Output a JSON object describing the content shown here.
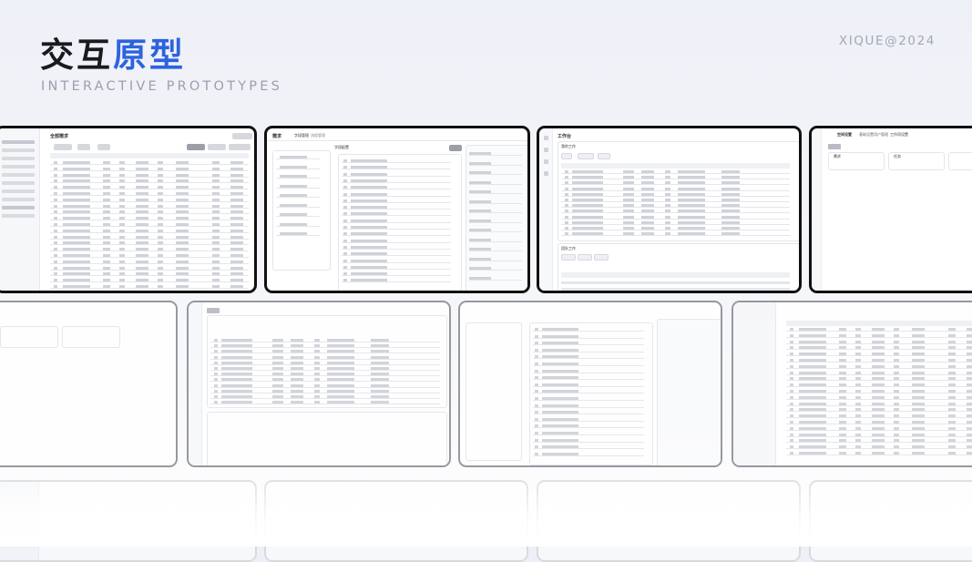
{
  "header": {
    "title_part1": "交互",
    "title_part2": "原型",
    "subtitle": "INTERACTIVE PROTOTYPES",
    "brand": "XIQUE@2024"
  },
  "colors": {
    "title": "#1a1a1e",
    "accent": "#2d63e0",
    "muted": "#9aa0ae",
    "frame": "#111111"
  },
  "cards": {
    "requirements": {
      "title": "全部需求"
    },
    "requirement_detail": {
      "title": "需求",
      "tab1": "字段管理",
      "tab2": "流程管理",
      "panel_title": "字段配置"
    },
    "workbench": {
      "title": "工作台",
      "section1": "我的工作",
      "section2": "团队工作"
    },
    "workspace_settings": {
      "title": "空间设置",
      "tab1": "基础设置",
      "tab2": "用户管理",
      "tab3": "工作项设置",
      "item1": "需求",
      "item2": "任务"
    }
  }
}
